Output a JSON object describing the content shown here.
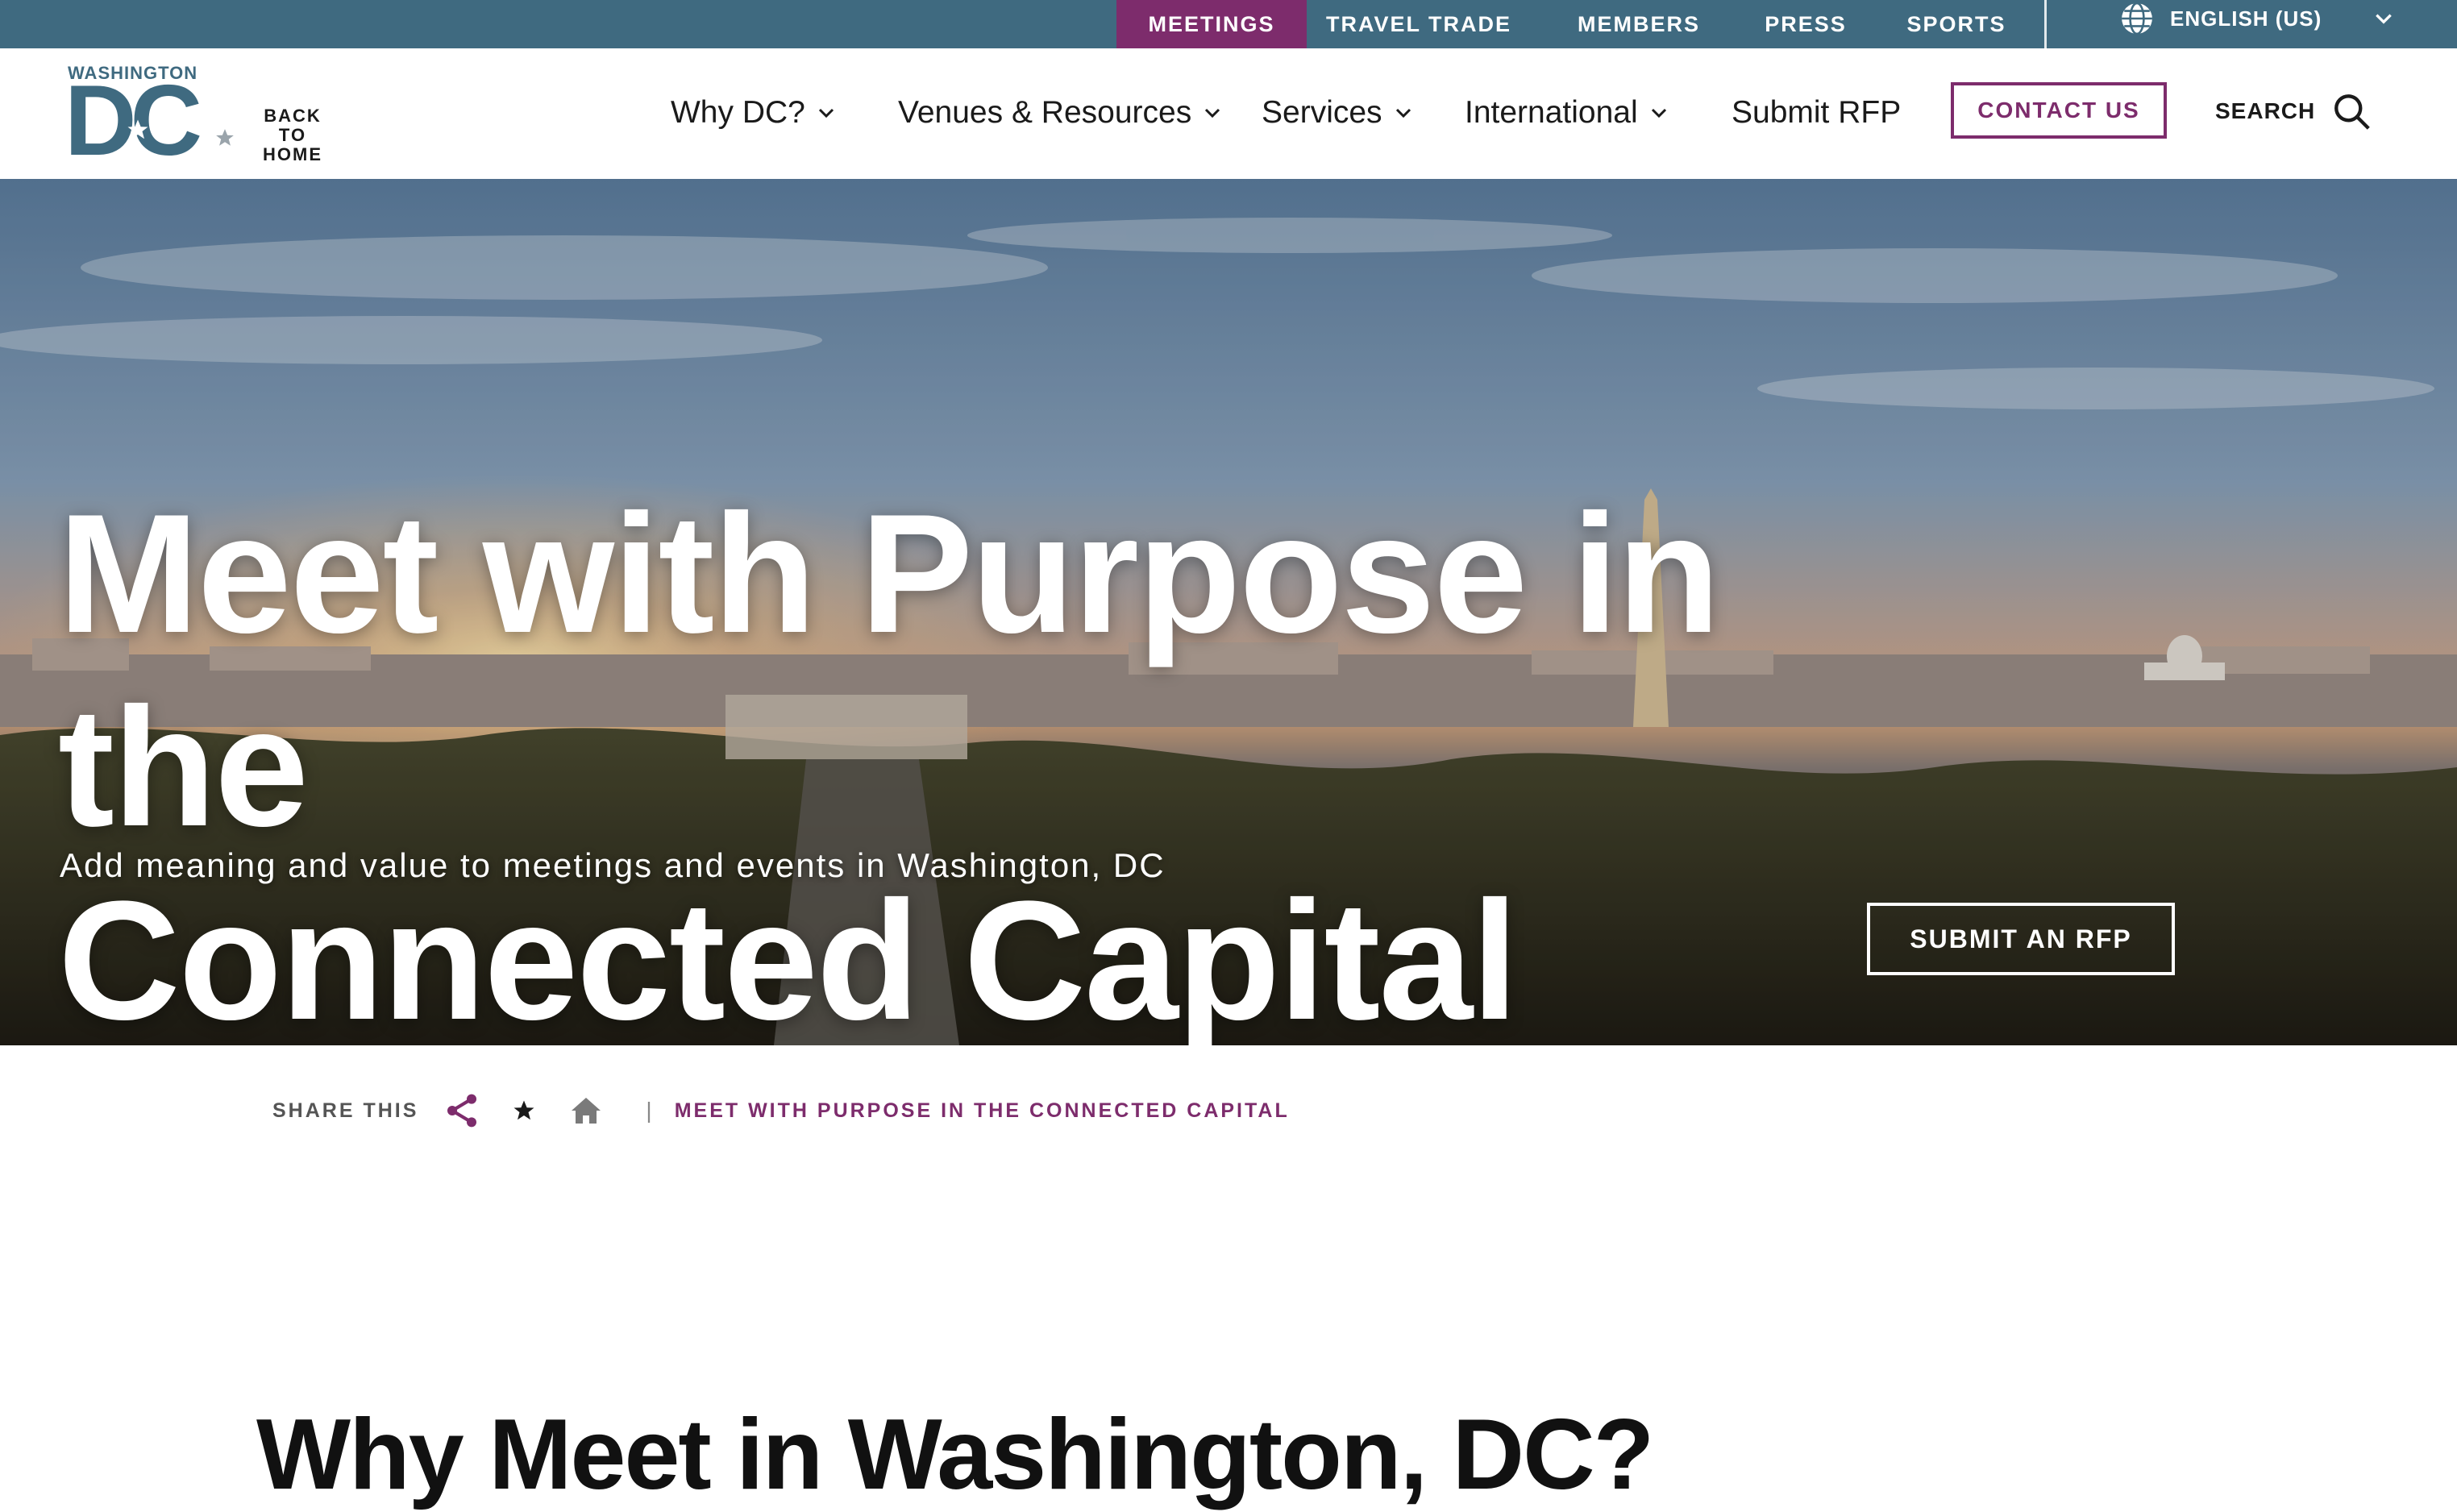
{
  "utility": {
    "tabs": [
      {
        "label": "MEETINGS",
        "active": true
      },
      {
        "label": "TRAVEL TRADE",
        "active": false
      },
      {
        "label": "MEMBERS",
        "active": false
      },
      {
        "label": "PRESS",
        "active": false
      },
      {
        "label": "SPORTS",
        "active": false
      }
    ],
    "language": "ENGLISH (US)"
  },
  "nav": {
    "logo_small": "WASHINGTON",
    "logo_big": "DC",
    "back_home": [
      "BACK",
      "TO",
      "HOME"
    ],
    "items": [
      {
        "label": "Why DC?",
        "has_dropdown": true
      },
      {
        "label": "Venues & Resources",
        "has_dropdown": true
      },
      {
        "label": "Services",
        "has_dropdown": true
      },
      {
        "label": "International",
        "has_dropdown": true
      },
      {
        "label": "Submit RFP",
        "has_dropdown": false
      }
    ],
    "contact_label": "CONTACT US",
    "search_label": "SEARCH"
  },
  "hero": {
    "title_line1": "Meet with Purpose in the",
    "title_line2": "Connected Capital",
    "subtitle": "Add meaning and value to meetings and events in Washington, DC",
    "cta_label": "SUBMIT AN RFP"
  },
  "share": {
    "label": "SHARE THIS",
    "separator": "|",
    "breadcrumb_current": "MEET WITH PURPOSE IN THE CONNECTED CAPITAL"
  },
  "section": {
    "heading": "Why Meet in Washington, DC?"
  },
  "colors": {
    "utility_bar": "#3f6a80",
    "accent_purple": "#7d2c6c",
    "brand_blue": "#3f6a80"
  },
  "icons": [
    "globe-icon",
    "chevron-down-icon",
    "search-icon",
    "share-icon",
    "star-icon",
    "home-icon"
  ]
}
